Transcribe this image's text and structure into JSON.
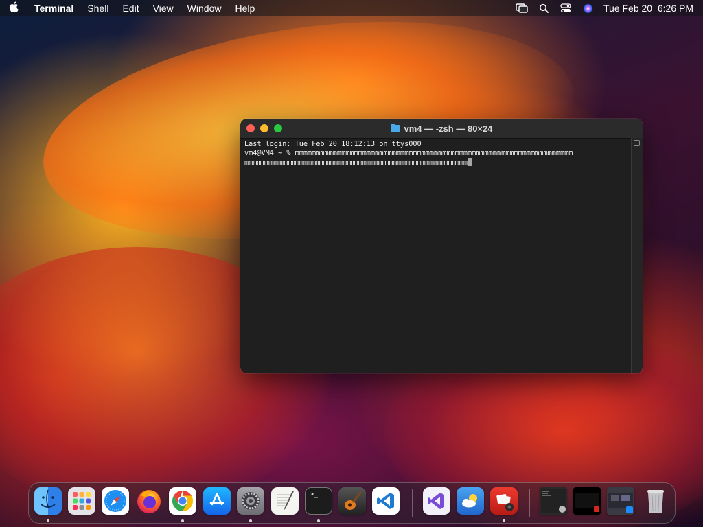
{
  "menubar": {
    "app_name": "Terminal",
    "menus": [
      "Shell",
      "Edit",
      "View",
      "Window",
      "Help"
    ],
    "clock": "Tue Feb 20  6:26 PM",
    "icons": [
      "apple-icon",
      "screen-mirroring-icon",
      "spotlight-search-icon",
      "control-center-icon",
      "siri-icon"
    ]
  },
  "terminal": {
    "title": "vm4 — -zsh — 80×24",
    "lines": [
      "Last login: Tue Feb 20 18:12:13 on ttys000",
      "vm4@VM4 ~ % mmmmmmmmmmmmmmmmmmmmmmmmmmmmmmmmmmmmmmmmmmmmmmmmmmmmmmmmmmmmmmmmmm",
      "mmmmmmmmmmmmmmmmmmmmmmmmmmmmmmmmmmmmmmmmmmmmmmmmmmmmm"
    ]
  },
  "dock": {
    "apps": [
      {
        "name": "finder-icon",
        "color": "#2f8cf0",
        "running": true
      },
      {
        "name": "launchpad-icon",
        "color": "#d9d9de",
        "running": false
      },
      {
        "name": "safari-icon",
        "color": "#1d8ef2",
        "running": false
      },
      {
        "name": "firefox-icon",
        "color": "#7c2ae8",
        "running": false
      },
      {
        "name": "chrome-icon",
        "color": "#ffffff",
        "running": true
      },
      {
        "name": "app-store-icon",
        "color": "#1a8cff",
        "running": false
      },
      {
        "name": "system-settings-icon",
        "color": "#8d8d93",
        "running": true
      },
      {
        "name": "textedit-icon",
        "color": "#f4f4f0",
        "running": false
      },
      {
        "name": "terminal-icon",
        "color": "#1c1c1c",
        "running": true
      },
      {
        "name": "garageband-icon",
        "color": "#3a3a3a",
        "running": false
      },
      {
        "name": "vscode-icon",
        "color": "#ffffff",
        "running": false
      },
      {
        "name": "visual-studio-icon",
        "color": "#f2f0f8",
        "running": false
      },
      {
        "name": "weather-icon",
        "color": "#2f7de0",
        "running": false
      },
      {
        "name": "photo-booth-icon",
        "color": "#d8261f",
        "running": true
      },
      {
        "name": "recent-window-thumbnail",
        "color": "#2a2a2a",
        "running": false
      },
      {
        "name": "recent-window-thumbnail-2",
        "color": "#111111",
        "running": false
      },
      {
        "name": "recent-window-thumbnail-3",
        "color": "#3a3a44",
        "running": false
      },
      {
        "name": "trash-icon",
        "color": "#c9c9cc",
        "running": false
      }
    ]
  }
}
